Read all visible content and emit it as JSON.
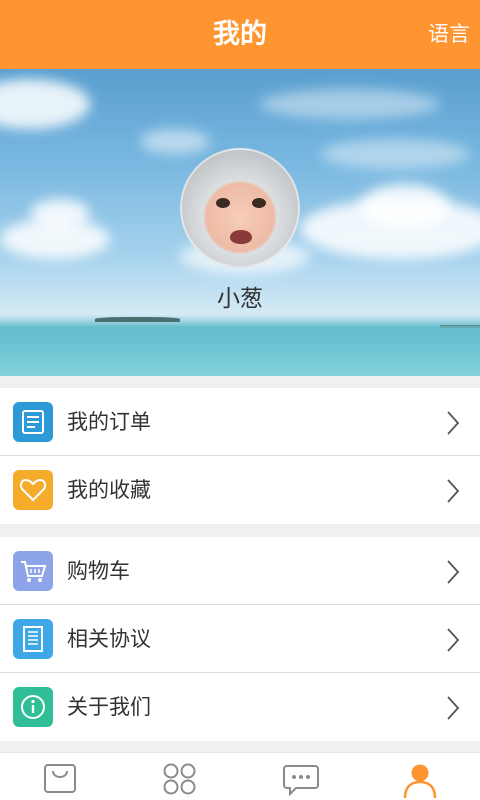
{
  "header": {
    "title": "我的",
    "language_label": "语言"
  },
  "profile": {
    "username": "小葱"
  },
  "menu_group1": [
    {
      "label": "我的订单",
      "icon": "order-list-icon",
      "color": "#2b9ad6"
    },
    {
      "label": "我的收藏",
      "icon": "heart-icon",
      "color": "#f5ac2a"
    }
  ],
  "menu_group2": [
    {
      "label": "购物车",
      "icon": "shopping-cart-icon",
      "color": "#8da4e8"
    },
    {
      "label": "相关协议",
      "icon": "document-icon",
      "color": "#3da7e8"
    },
    {
      "label": "关于我们",
      "icon": "info-icon",
      "color": "#2fbe96"
    }
  ],
  "tabbar": [
    {
      "icon": "shopping-bag-icon",
      "active": false
    },
    {
      "icon": "grid-icon",
      "active": false
    },
    {
      "icon": "message-icon",
      "active": false
    },
    {
      "icon": "person-icon",
      "active": true
    }
  ],
  "colors": {
    "accent": "#ff9530",
    "inactive_icon": "#8a8a8a"
  }
}
